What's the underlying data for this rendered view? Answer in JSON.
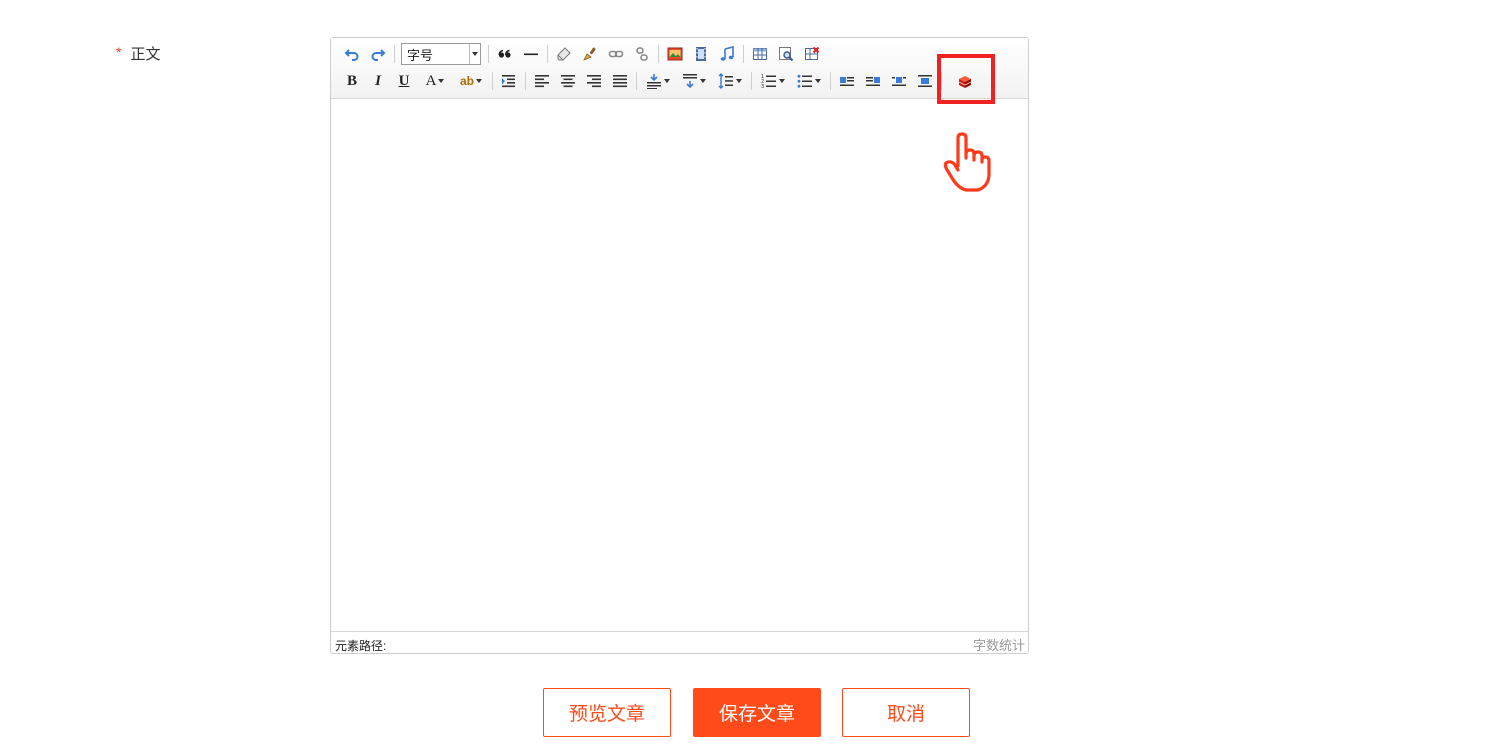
{
  "form": {
    "body_label": "正文",
    "required_mark": "*"
  },
  "editor": {
    "font_size_select": "字号",
    "status_path": "元素路径:",
    "word_count": "字数统计",
    "toolbar_row1": [
      "undo-icon",
      "redo-icon",
      "font-size-select",
      "blockquote-icon",
      "horizontal-rule-icon",
      "eraser-icon",
      "format-brush-icon",
      "link-icon",
      "unlink-icon",
      "image-icon",
      "video-icon",
      "music-icon",
      "table-icon",
      "search-replace-icon",
      "delete-table-icon"
    ],
    "toolbar_row2": [
      "bold-icon",
      "italic-icon",
      "underline-icon",
      "font-color-icon",
      "highlight-color-icon",
      "indent-icon",
      "align-left-icon",
      "align-center-icon",
      "align-right-icon",
      "align-justify-icon",
      "row-spacing-top-icon",
      "row-spacing-bottom-icon",
      "line-height-icon",
      "ordered-list-icon",
      "unordered-list-icon",
      "image-left-icon",
      "image-right-icon",
      "image-center-icon",
      "image-none-icon",
      "custom-plugin-icon"
    ],
    "bold_glyph": "B",
    "italic_glyph": "I",
    "underline_glyph": "U",
    "font_color_glyph": "A",
    "highlight_glyph": "ab"
  },
  "annotation": {
    "highlight_color": "#ee2222",
    "pointer": "hand-pointer-icon"
  },
  "actions": {
    "preview": "预览文章",
    "save": "保存文章",
    "cancel": "取消"
  },
  "colors": {
    "accent": "#ff4a1a",
    "icon_blue": "#3a7bd5"
  }
}
